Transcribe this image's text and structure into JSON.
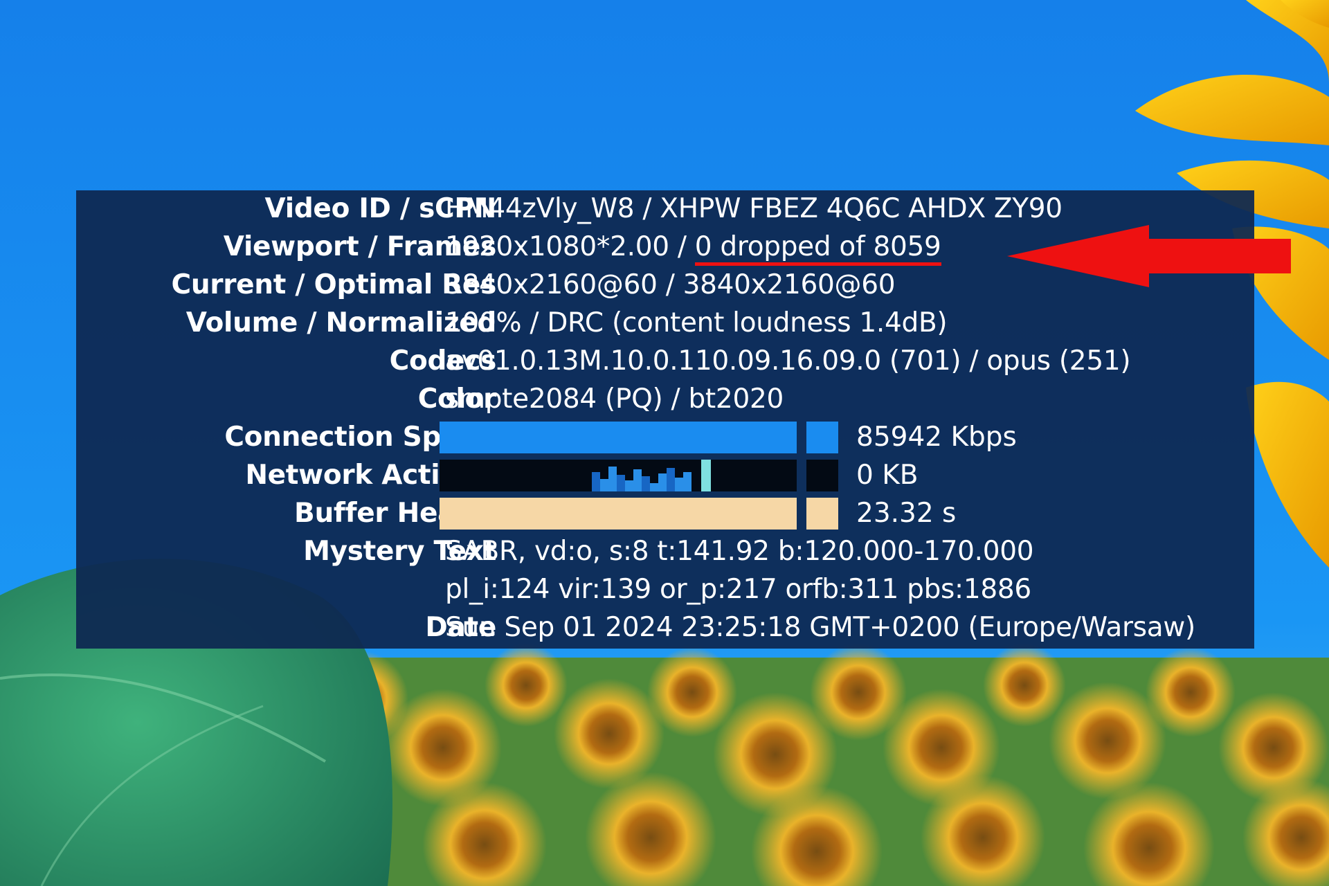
{
  "stats_for_nerds": {
    "rows": [
      {
        "label": "Video ID / sCPN",
        "value": "HM44zVly_W8 / XHPW FBEZ 4Q6C AHDX ZY90"
      },
      {
        "label": "Viewport / Frames",
        "value_prefix": "1920x1080*2.00 / ",
        "value_highlight": "0 dropped of 8059"
      },
      {
        "label": "Current / Optimal Res",
        "value": "3840x2160@60 / 3840x2160@60"
      },
      {
        "label": "Volume / Normalized",
        "value": "100% / DRC (content loudness 1.4dB)"
      },
      {
        "label": "Codecs",
        "value": "av01.0.13M.10.0.110.09.16.09.0 (701) / opus (251)"
      },
      {
        "label": "Color",
        "value": "smpte2084 (PQ) / bt2020"
      },
      {
        "label": "Connection Speed",
        "value": "85942 Kbps",
        "fill_fraction": 1.0,
        "fill_color": "#1a8cf0",
        "track_color": "#1a8cf0"
      },
      {
        "label": "Network Activity",
        "value": "0 KB",
        "fill_fraction": 0.0,
        "fill_color": "#2a8fe8",
        "track_color": "#030a14"
      },
      {
        "label": "Buffer Health",
        "value": "23.32 s",
        "fill_fraction": 1.0,
        "fill_color": "#f6d7a6",
        "track_color": "#f6d7a6"
      },
      {
        "label": "Mystery Text",
        "value": "SABR, vd:o, s:8 t:141.92 b:120.000-170.000"
      },
      {
        "label": "",
        "value": "pl_i:124 vir:139 or_p:217 orfb:311 pbs:1886"
      },
      {
        "label": "Date",
        "value": "Sun Sep 01 2024 23:25:18 GMT+0200 (Europe/Warsaw)"
      }
    ]
  },
  "annotation": {
    "highlight_color": "#ee1111",
    "arrow_color": "#ee1111",
    "arrow_icon": "left-arrow-icon"
  },
  "colors": {
    "panel_background": "#0e2852",
    "sky": "#1688ee",
    "sunflower_petals": "#f5b800",
    "leaf": "#2f9a6a"
  }
}
